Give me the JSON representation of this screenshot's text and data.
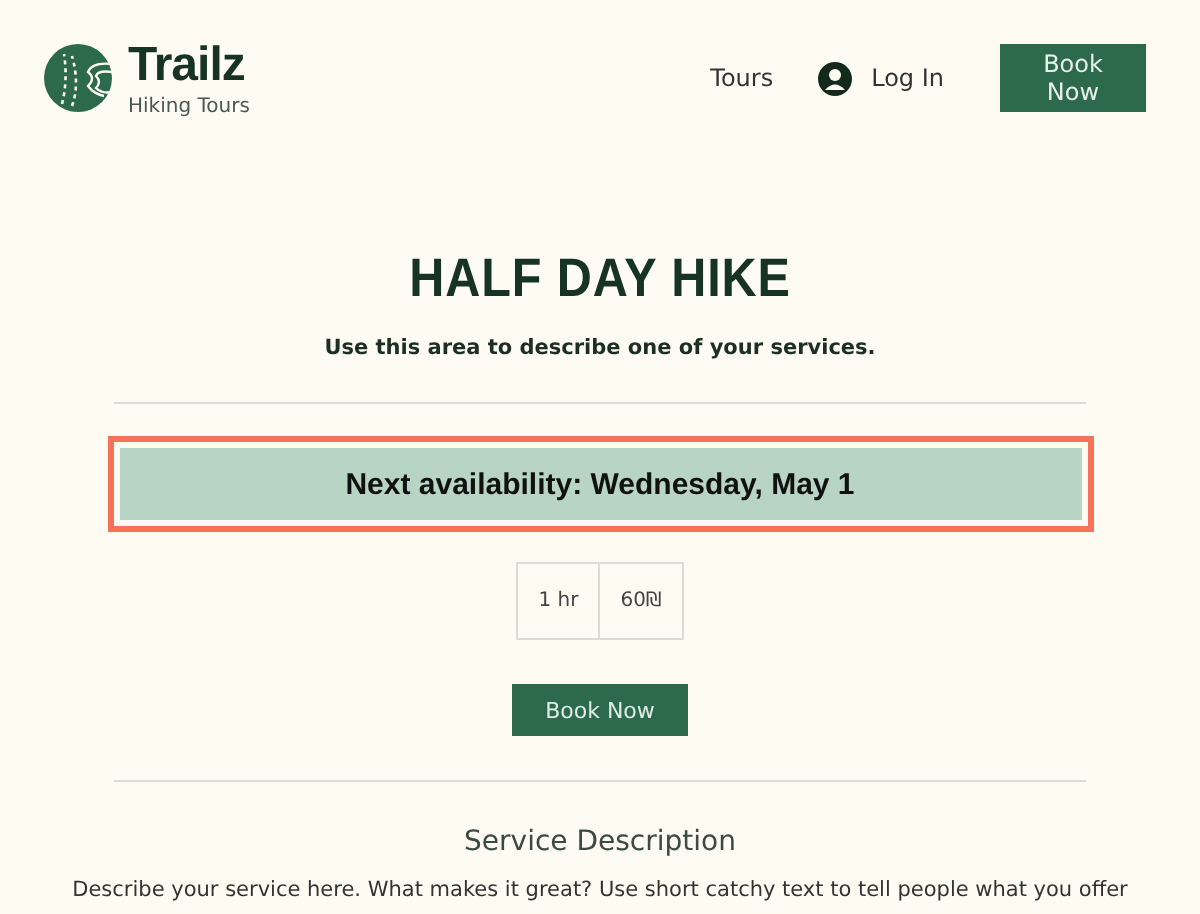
{
  "header": {
    "brand": "Trailz",
    "tagline": "Hiking Tours",
    "nav": [
      {
        "label": "Tours",
        "kind": "link"
      },
      {
        "label": "Log In",
        "kind": "login"
      },
      {
        "label": "Book Now",
        "kind": "button"
      }
    ]
  },
  "service": {
    "title": "HALF DAY HIKE",
    "subtitle": "Use this area to describe one of your services.",
    "availability": {
      "text": "Next availability: Wednesday, May 1",
      "highlighted": true
    },
    "details": [
      "1 hr",
      "60₪"
    ],
    "book_button": "Book Now",
    "description_heading": "Service Description",
    "description": "Describe your service here. What makes it great? Use short catchy text to tell people what you offer"
  }
}
